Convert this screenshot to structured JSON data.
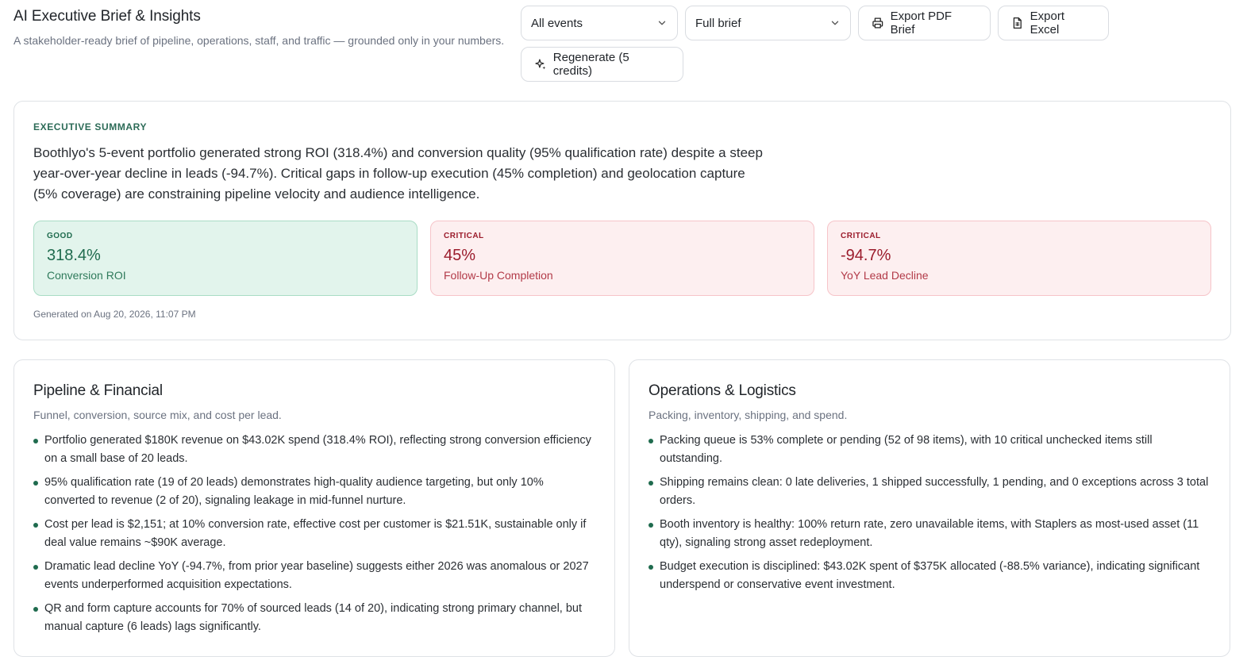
{
  "header": {
    "title": "AI Executive Brief & Insights",
    "subtitle": "A stakeholder-ready brief of pipeline, operations, staff, and traffic — grounded only in your numbers."
  },
  "toolbar": {
    "event_select": {
      "value": "All events",
      "icon": "chevron-down-icon"
    },
    "brief_select": {
      "value": "Full brief",
      "icon": "chevron-down-icon"
    },
    "export_pdf_label": "Export PDF Brief",
    "export_excel_label": "Export Excel",
    "regenerate_label": "Regenerate (5 credits)"
  },
  "summary": {
    "eyebrow": "EXECUTIVE SUMMARY",
    "text": "Boothlyo's 5-event portfolio generated strong ROI (318.4%) and conversion quality (95% qualification rate) despite a steep year-over-year decline in leads (-94.7%). Critical gaps in follow-up execution (45% completion) and geolocation capture (5% coverage) are constraining pipeline velocity and audience intelligence.",
    "kpis": [
      {
        "status": "GOOD",
        "value": "318.4%",
        "label": "Conversion ROI"
      },
      {
        "status": "CRITICAL",
        "value": "45%",
        "label": "Follow-Up Completion"
      },
      {
        "status": "CRITICAL",
        "value": "-94.7%",
        "label": "YoY Lead Decline"
      }
    ],
    "generated": "Generated on Aug 20, 2026, 11:07 PM"
  },
  "sections": [
    {
      "title": "Pipeline & Financial",
      "subtitle": "Funnel, conversion, source mix, and cost per lead.",
      "bullets": [
        "Portfolio generated $180K revenue on $43.02K spend (318.4% ROI), reflecting strong conversion efficiency on a small base of 20 leads.",
        "95% qualification rate (19 of 20 leads) demonstrates high-quality audience targeting, but only 10% converted to revenue (2 of 20), signaling leakage in mid-funnel nurture.",
        "Cost per lead is $2,151; at 10% conversion rate, effective cost per customer is $21.51K, sustainable only if deal value remains ~$90K average.",
        "Dramatic lead decline YoY (-94.7%, from prior year baseline) suggests either 2026 was anomalous or 2027 events underperformed acquisition expectations.",
        "QR and form capture accounts for 70% of sourced leads (14 of 20), indicating strong primary channel, but manual capture (6 leads) lags significantly."
      ]
    },
    {
      "title": "Operations & Logistics",
      "subtitle": "Packing, inventory, shipping, and spend.",
      "bullets": [
        "Packing queue is 53% complete or pending (52 of 98 items), with 10 critical unchecked items still outstanding.",
        "Shipping remains clean: 0 late deliveries, 1 shipped successfully, 1 pending, and 0 exceptions across 3 total orders.",
        "Booth inventory is healthy: 100% return rate, zero unavailable items, with Staplers as most-used asset (11 qty), signaling strong asset redeployment.",
        "Budget execution is disciplined: $43.02K spent of $375K allocated (-88.5% variance), indicating significant underspend or conservative event investment."
      ]
    }
  ]
}
